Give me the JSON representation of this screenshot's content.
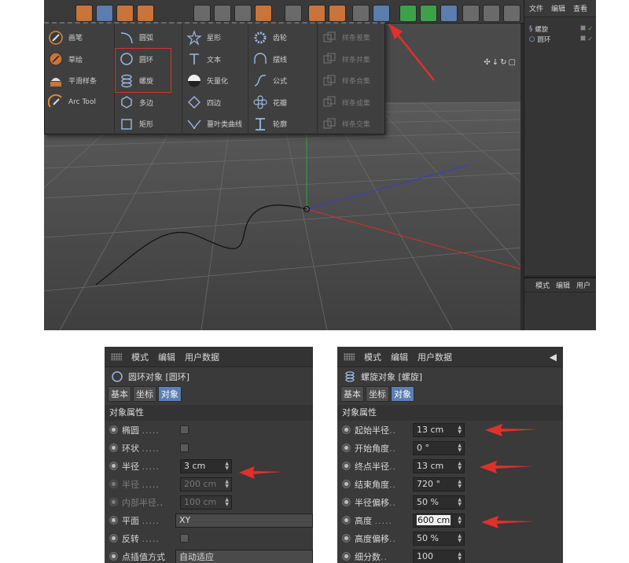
{
  "object_manager": {
    "menu": [
      "文件",
      "编辑",
      "查看"
    ],
    "objects": [
      {
        "name": "螺旋"
      },
      {
        "name": "圆环"
      }
    ]
  },
  "attr_mini": {
    "menu": [
      "模式",
      "编辑",
      "用户"
    ]
  },
  "spline_menu": {
    "columns": [
      [
        {
          "label": "画笔",
          "icon": "pen-icon",
          "enabled": true
        },
        {
          "label": "草绘",
          "icon": "sketch-icon",
          "enabled": true
        },
        {
          "label": "平滑样条",
          "icon": "smooth-spline-icon",
          "enabled": true
        },
        {
          "label": "Arc Tool",
          "icon": "arc-tool-icon",
          "enabled": true
        }
      ],
      [
        {
          "label": "圆弧",
          "icon": "arc-icon",
          "enabled": true
        },
        {
          "label": "圆环",
          "icon": "circle-icon",
          "enabled": true
        },
        {
          "label": "螺旋",
          "icon": "helix-icon",
          "enabled": true
        },
        {
          "label": "多边",
          "icon": "polygon-icon",
          "enabled": true
        },
        {
          "label": "矩形",
          "icon": "rectangle-icon",
          "enabled": true
        }
      ],
      [
        {
          "label": "星形",
          "icon": "star-icon",
          "enabled": true
        },
        {
          "label": "文本",
          "icon": "text-icon",
          "enabled": true
        },
        {
          "label": "矢量化",
          "icon": "vectorizer-icon",
          "enabled": true
        },
        {
          "label": "四边",
          "icon": "four-side-icon",
          "enabled": true
        },
        {
          "label": "蔓叶类曲线",
          "icon": "cissoid-icon",
          "enabled": true
        }
      ],
      [
        {
          "label": "齿轮",
          "icon": "cog-icon",
          "enabled": true
        },
        {
          "label": "摆线",
          "icon": "cycloid-icon",
          "enabled": true
        },
        {
          "label": "公式",
          "icon": "formula-icon",
          "enabled": true
        },
        {
          "label": "花瓣",
          "icon": "flower-icon",
          "enabled": true
        },
        {
          "label": "轮廓",
          "icon": "profile-icon",
          "enabled": true
        }
      ],
      [
        {
          "label": "样条差集",
          "icon": "spline-subtract-icon",
          "enabled": false
        },
        {
          "label": "样条并集",
          "icon": "spline-union-icon",
          "enabled": false
        },
        {
          "label": "样条合集",
          "icon": "spline-and-icon",
          "enabled": false
        },
        {
          "label": "样条或集",
          "icon": "spline-or-icon",
          "enabled": false
        },
        {
          "label": "样条交集",
          "icon": "spline-intersect-icon",
          "enabled": false
        }
      ]
    ]
  },
  "panel_circle": {
    "menu": [
      "模式",
      "编辑",
      "用户数据"
    ],
    "object_title": "圆环对象 [圆环]",
    "tabs": [
      "基本",
      "坐标",
      "对象"
    ],
    "active_tab": "对象",
    "section": "对象属性",
    "rows": [
      {
        "label": "椭圆",
        "type": "checkbox",
        "enabled": true
      },
      {
        "label": "环状",
        "type": "checkbox",
        "enabled": true
      },
      {
        "label": "半径",
        "type": "number",
        "value": "3 cm",
        "enabled": true
      },
      {
        "label": "半径",
        "type": "number",
        "value": "200 cm",
        "enabled": false
      },
      {
        "label": "内部半径",
        "type": "number",
        "value": "100 cm",
        "enabled": false
      },
      {
        "label": "平面",
        "type": "select",
        "value": "XY",
        "enabled": true
      },
      {
        "label": "反转",
        "type": "checkbox",
        "enabled": true
      },
      {
        "label": "点插值方式",
        "type": "select",
        "value": "自动适应",
        "enabled": true
      }
    ]
  },
  "panel_helix": {
    "menu": [
      "模式",
      "编辑",
      "用户数据"
    ],
    "object_title": "螺旋对象 [螺旋]",
    "tabs": [
      "基本",
      "坐标",
      "对象"
    ],
    "active_tab": "对象",
    "section": "对象属性",
    "rows": [
      {
        "label": "起始半径",
        "type": "number",
        "value": "13 cm",
        "enabled": true
      },
      {
        "label": "开始角度",
        "type": "number",
        "value": "0 °",
        "enabled": true
      },
      {
        "label": "终点半径",
        "type": "number",
        "value": "13 cm",
        "enabled": true
      },
      {
        "label": "结束角度",
        "type": "number",
        "value": "720 °",
        "enabled": true
      },
      {
        "label": "半径偏移",
        "type": "number",
        "value": "50 %",
        "enabled": true
      },
      {
        "label": "高度",
        "type": "number",
        "value": "600 cm",
        "enabled": true,
        "editing": true
      },
      {
        "label": "高度偏移",
        "type": "number",
        "value": "50 %",
        "enabled": true
      },
      {
        "label": "细分数",
        "type": "number",
        "value": "100",
        "enabled": true
      }
    ]
  },
  "colors": {
    "annotation_red": "#e0302a",
    "axis_x": "#d03030",
    "axis_y": "#30a040",
    "axis_z": "#3a3ad0",
    "active_tab": "#5a7fb3"
  }
}
